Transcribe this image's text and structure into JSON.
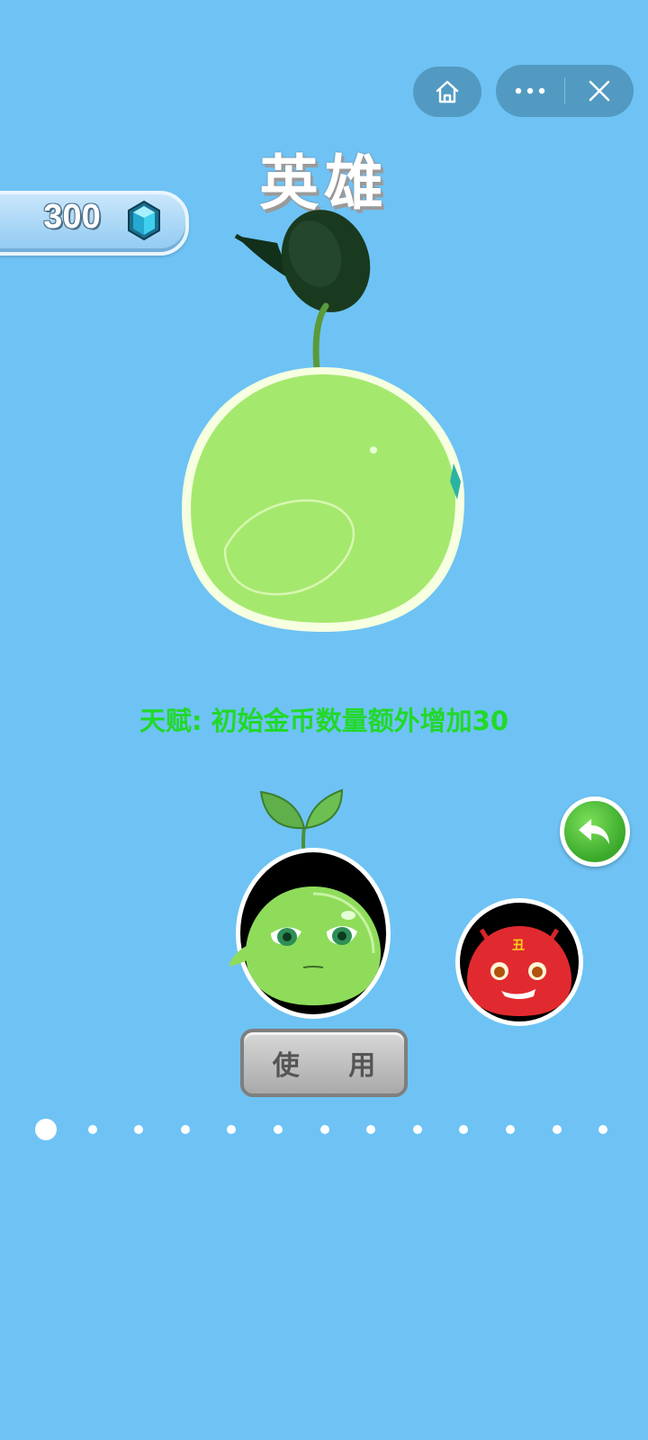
{
  "capsule": {
    "home_icon": "home-icon",
    "more_icon": "more-dots-icon",
    "close_icon": "close-icon"
  },
  "title": "英雄",
  "currency": {
    "amount": "300",
    "icon": "diamond-gem-icon",
    "gem_color": "#3fd0ef"
  },
  "hero": {
    "name_icon": "green-sprout-slime",
    "talent_text": "天赋: 初始金币数量额外增加30",
    "talent_color": "#22d82a",
    "slime_color": "#a5e86e"
  },
  "selector": {
    "use_label": "使 用",
    "back_icon": "undo-arrow-icon",
    "heroes": [
      {
        "icon": "green-slime-avatar",
        "selected": true
      },
      {
        "icon": "red-devil-slime-avatar",
        "selected": false
      }
    ]
  },
  "pagination": {
    "total": 13,
    "current": 1
  }
}
